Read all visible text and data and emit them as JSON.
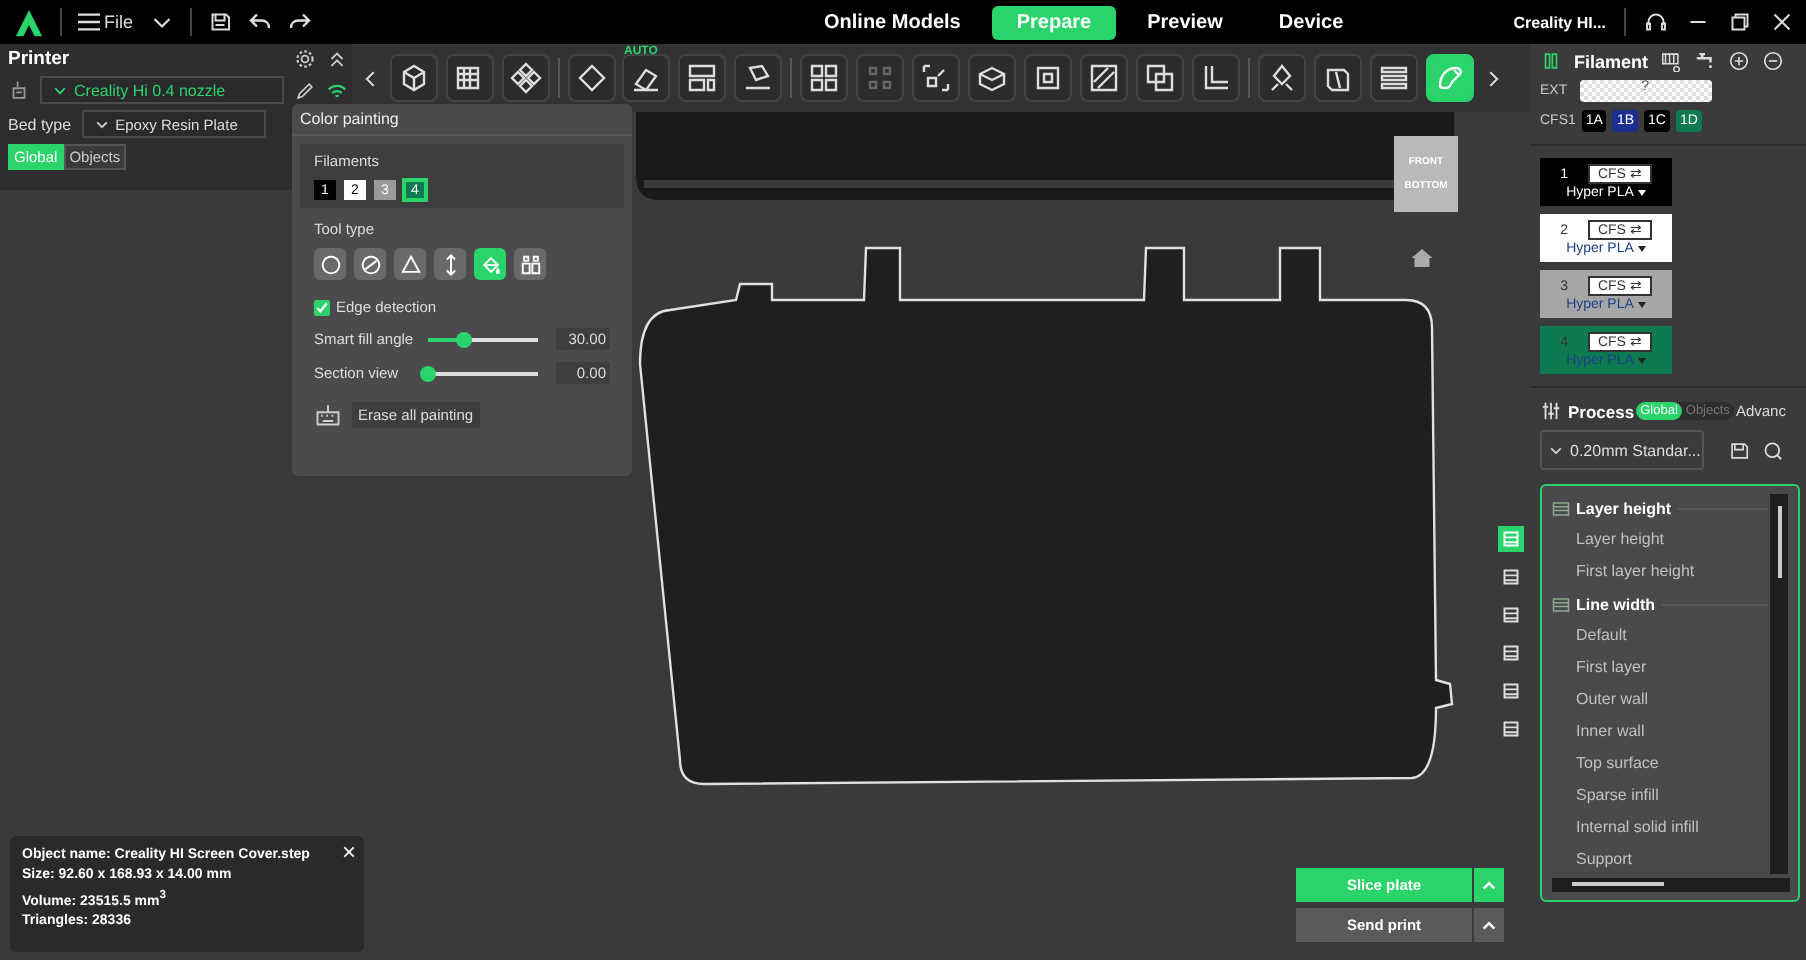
{
  "menu": {
    "file": "File"
  },
  "tabs": [
    {
      "label": "Online Models",
      "selected": false
    },
    {
      "label": "Prepare",
      "selected": true
    },
    {
      "label": "Preview",
      "selected": false
    },
    {
      "label": "Device",
      "selected": false
    }
  ],
  "account": "Creality HI...",
  "printer_panel": {
    "title": "Printer",
    "nozzle": "Creality Hi 0.4 nozzle",
    "bed_type_label": "Bed type",
    "bed_type": "Epoxy Resin Plate",
    "scope_tabs": [
      {
        "label": "Global",
        "selected": true
      },
      {
        "label": "Objects",
        "selected": false
      }
    ]
  },
  "toolbar": [
    {
      "kind": "cube_add",
      "selected": false,
      "disabled": false
    },
    {
      "kind": "plate_add",
      "selected": false,
      "disabled": false
    },
    {
      "kind": "arrange",
      "selected": false,
      "disabled": false
    },
    {
      "kind": "orient",
      "selected": false,
      "disabled": false
    },
    {
      "kind": "auto_orient",
      "selected": false,
      "disabled": false,
      "badge": "AUTO"
    },
    {
      "kind": "layout",
      "selected": false,
      "disabled": false
    },
    {
      "kind": "lay_face",
      "selected": false,
      "disabled": false
    },
    {
      "kind": "split",
      "selected": false,
      "disabled": false
    },
    {
      "kind": "split_parts",
      "selected": false,
      "disabled": true
    },
    {
      "kind": "scale",
      "selected": false,
      "disabled": false
    },
    {
      "kind": "cut",
      "selected": false,
      "disabled": false
    },
    {
      "kind": "hollow",
      "selected": false,
      "disabled": false
    },
    {
      "kind": "slash",
      "selected": false,
      "disabled": false
    },
    {
      "kind": "boolean",
      "selected": false,
      "disabled": false
    },
    {
      "kind": "l_shape",
      "selected": false,
      "disabled": false
    },
    {
      "kind": "support",
      "selected": false,
      "disabled": false
    },
    {
      "kind": "seam",
      "selected": false,
      "disabled": false
    },
    {
      "kind": "layers",
      "selected": false,
      "disabled": false
    },
    {
      "kind": "paint",
      "selected": true,
      "disabled": false
    }
  ],
  "color_painting": {
    "title": "Color painting",
    "filaments_label": "Filaments",
    "filaments": [
      {
        "label": "1",
        "color": "#000000",
        "selected": false
      },
      {
        "label": "2",
        "color": "#ffffff",
        "selected": false
      },
      {
        "label": "3",
        "color": "#9a9a9a",
        "selected": false
      },
      {
        "label": "4",
        "color": "#0e7a50",
        "selected": true
      }
    ],
    "tool_type_label": "Tool type",
    "tool_types": [
      {
        "kind": "circle",
        "selected": false
      },
      {
        "kind": "sphere",
        "selected": false
      },
      {
        "kind": "triangle",
        "selected": false
      },
      {
        "kind": "height",
        "selected": false
      },
      {
        "kind": "fill",
        "selected": true
      },
      {
        "kind": "gap",
        "selected": false
      }
    ],
    "edge_detection": {
      "label": "Edge detection",
      "checked": true
    },
    "sliders": [
      {
        "label": "Smart fill angle",
        "level": 0.33,
        "reading": "30.00"
      },
      {
        "label": "Section view",
        "level": 0,
        "reading": "0.00"
      }
    ],
    "erase": "Erase all painting"
  },
  "nav_cube": {
    "front": "FRONT",
    "bottom": "BOTTOM"
  },
  "object_info": [
    "Object name: Creality HI Screen Cover.step",
    "Size: 92.60 x 168.93 x 14.00 mm",
    "Volume: 23515.5 mm$^{3}$",
    "Triangles: 28336"
  ],
  "object_info_close": "×",
  "actions": [
    {
      "label": "Slice plate",
      "primary": true
    },
    {
      "label": "Send print",
      "primary": false
    }
  ],
  "filament_panel": {
    "title": "Filament",
    "ext_label": "EXT",
    "ext_value": "?",
    "cfs_label": "CFS1",
    "slots": [
      {
        "label": "1A",
        "color": "#000000"
      },
      {
        "label": "1B",
        "color": "#1a2f8f"
      },
      {
        "label": "1C",
        "color": "#000000"
      },
      {
        "label": "1D",
        "color": "#0e7a50"
      }
    ],
    "filaments": [
      {
        "number": "1",
        "tag": "CFS ⇄",
        "type": "Hyper PLA",
        "color": "#000000"
      },
      {
        "number": "2",
        "tag": "CFS ⇄",
        "type": "Hyper PLA",
        "color": "#ffffff"
      },
      {
        "number": "3",
        "tag": "CFS ⇄",
        "type": "Hyper PLA",
        "color": "#a6a6a6"
      },
      {
        "number": "4",
        "tag": "CFS ⇄",
        "type": "Hyper PLA",
        "color": "#0e7a50"
      }
    ]
  },
  "process": {
    "title": "Process",
    "scope_tabs": [
      {
        "label": "Global",
        "selected": true
      },
      {
        "label": "Objects",
        "selected": false
      }
    ],
    "advanced": "Advanc",
    "preset": "0.20mm Standar...",
    "side_tabs": [
      {
        "selected": true
      },
      {
        "selected": false
      },
      {
        "selected": false
      },
      {
        "selected": false
      },
      {
        "selected": false
      },
      {
        "selected": false
      }
    ],
    "groups": [
      {
        "title": "Layer height",
        "items": [
          "Layer height",
          "First layer height"
        ]
      },
      {
        "title": "Line width",
        "items": [
          "Default",
          "First layer",
          "Outer wall",
          "Inner wall",
          "Top surface",
          "Sparse infill",
          "Internal solid infill",
          "Support"
        ]
      }
    ]
  }
}
